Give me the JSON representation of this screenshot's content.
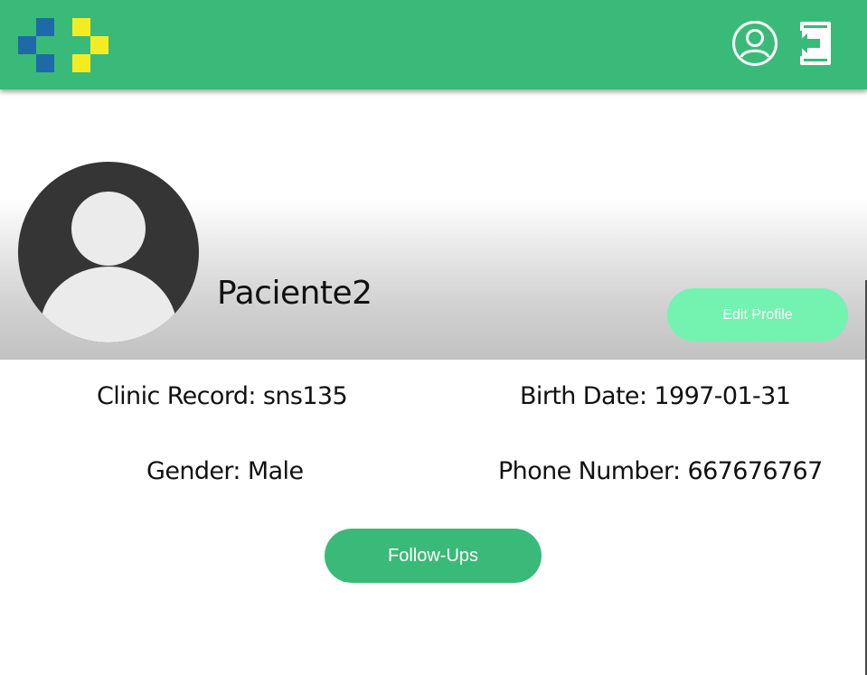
{
  "header": {
    "logo_name": "app-logo",
    "icons": [
      "user-profile-icon",
      "logout-icon"
    ],
    "colors": {
      "bar": "#3aba78",
      "logo_blue": "#1e6aa8",
      "logo_yellow": "#f4ec23"
    }
  },
  "profile": {
    "username": "Paciente2",
    "edit_label": "Edit Profile",
    "edit_color": "#74f2b0"
  },
  "details": {
    "clinic_record_label": "Clinic Record:",
    "clinic_record_value": "sns135",
    "birth_date_label": "Birth Date:",
    "birth_date_value": "1997-01-31",
    "gender_label": "Gender:",
    "gender_value": "Male",
    "phone_label": "Phone Number:",
    "phone_value": "667676767"
  },
  "actions": {
    "follow_ups_label": "Follow-Ups"
  }
}
